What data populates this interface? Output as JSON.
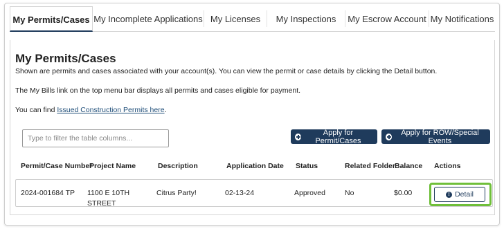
{
  "tabs": [
    {
      "label": "My Permits/Cases"
    },
    {
      "label": "My Incomplete Applications"
    },
    {
      "label": "My Licenses"
    },
    {
      "label": "My Inspections"
    },
    {
      "label": "My Escrow Account"
    },
    {
      "label": "My Notifications"
    }
  ],
  "page": {
    "title": "My Permits/Cases",
    "description": "Shown are permits and cases associated with your account(s). You can view the permit or case details by clicking the Detail button.",
    "bills_note": "The My Bills link on the top menu bar displays all permits and cases eligible for payment.",
    "find_prefix": "You can find ",
    "find_link": "Issued Construction Permits here",
    "find_suffix": "."
  },
  "filter": {
    "placeholder": "Type to filter the table columns..."
  },
  "buttons": {
    "apply_permit": "Apply for Permit/Cases",
    "apply_row": "Apply for ROW/Special Events"
  },
  "table": {
    "headers": [
      "Permit/Case Number",
      "Project Name",
      "Description",
      "Application Date",
      "Status",
      "Related Folder",
      "Balance",
      "Actions"
    ],
    "rows": [
      {
        "permit_number": "2024-001684 TP",
        "project_name_line1": "1100 E 10TH",
        "project_name_line2": "STREET",
        "description": "Citrus Party!",
        "application_date": "02-13-24",
        "status": "Approved",
        "related_folder": "No",
        "balance": "$0.00",
        "action_label": "Detail"
      }
    ]
  },
  "colors": {
    "primary": "#1f3b5c",
    "highlight": "#6fbf3a"
  }
}
